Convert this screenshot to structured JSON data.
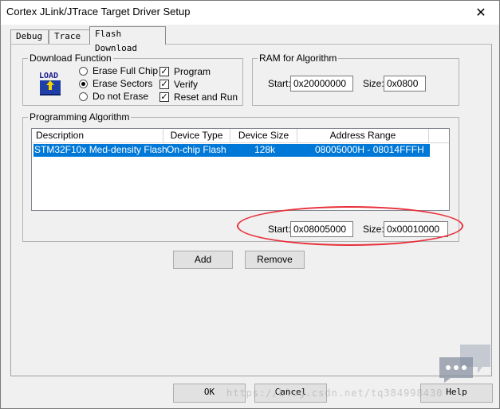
{
  "window": {
    "title": "Cortex JLink/JTrace Target Driver Setup",
    "close_glyph": "✕"
  },
  "tabs": [
    {
      "label": "Debug"
    },
    {
      "label": "Trace"
    },
    {
      "label": "Flash Download"
    }
  ],
  "download_function": {
    "legend": "Download Function",
    "icon_text": "LOAD",
    "options": [
      {
        "label": "Erase Full Chip",
        "selected": false
      },
      {
        "label": "Erase Sectors",
        "selected": true
      },
      {
        "label": "Do not Erase",
        "selected": false
      }
    ],
    "checks": [
      {
        "label": "Program",
        "checked": true
      },
      {
        "label": "Verify",
        "checked": true
      },
      {
        "label": "Reset and Run",
        "checked": true
      }
    ]
  },
  "ram": {
    "legend": "RAM for Algorithm",
    "start_label": "Start:",
    "start_value": "0x20000000",
    "size_label": "Size:",
    "size_value": "0x0800"
  },
  "programming_algorithm": {
    "legend": "Programming Algorithm",
    "columns": [
      "Description",
      "Device Type",
      "Device Size",
      "Address Range"
    ],
    "rows": [
      {
        "description": "STM32F10x Med-density Flash",
        "device_type": "On-chip Flash",
        "device_size": "128k",
        "address_range": "08005000H - 08014FFFH"
      }
    ],
    "start_label": "Start:",
    "start_value": "0x08005000",
    "size_label": "Size:",
    "size_value": "0x00010000"
  },
  "buttons": {
    "add": "Add",
    "remove": "Remove",
    "ok": "OK",
    "cancel": "Cancel",
    "help": "Help"
  },
  "watermark": "https://blog.csdn.net/tq384998430"
}
